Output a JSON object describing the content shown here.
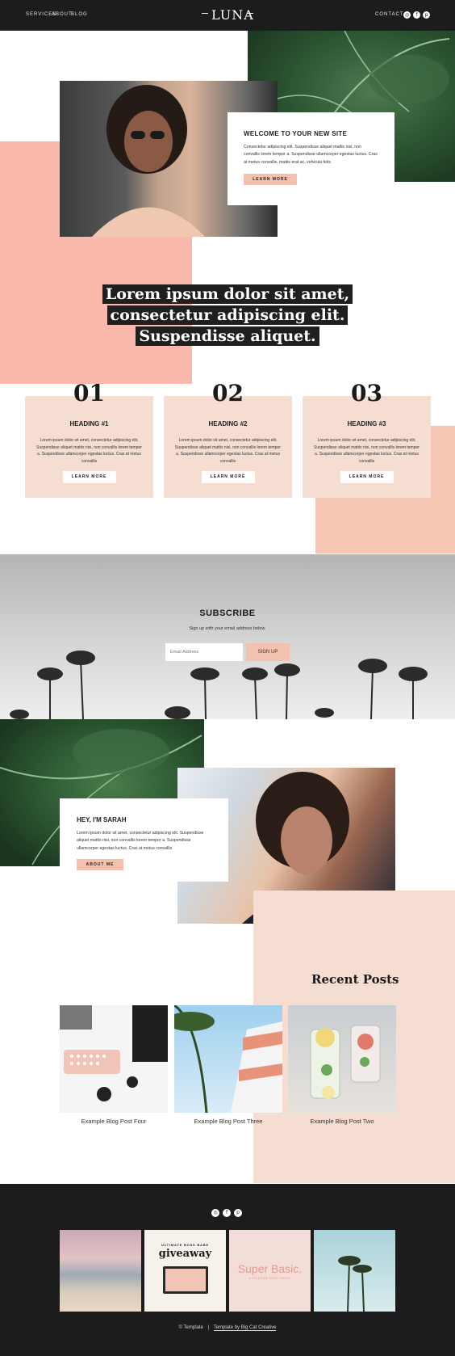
{
  "header": {
    "nav": [
      "SERVICES",
      "ABOUT",
      "BLOG"
    ],
    "logo": "LUNA",
    "contact": "CONTACT",
    "social_icons": [
      "instagram-icon",
      "facebook-icon",
      "pinterest-icon"
    ]
  },
  "welcome": {
    "title": "WELCOME TO YOUR NEW SITE",
    "text": "Consectetur adipiscing elit. Suspendisse aliquet mattis nisi, non convallis lorem tempor a. Suspendisse ullamcorper egestas luctus. Cras at metus convallis, mattis erat ac, vehicula felis.",
    "button": "LEARN MORE"
  },
  "headline": {
    "lines": [
      "Lorem ipsum dolor sit amet,",
      "consectetur adipiscing elit.",
      "Suspendisse aliquet."
    ]
  },
  "features": [
    {
      "number": "01",
      "heading": "HEADING #1",
      "text": "Lorem ipsum dolor sit amet, consectetur adipiscing elit. Suspendisse aliquet mattis nisi, non convallis lorem tempor a. Suspendisse ullamcorper egestas luctus. Cras at metus convallis",
      "button": "LEARN MORE"
    },
    {
      "number": "02",
      "heading": "HEADING #2",
      "text": "Lorem ipsum dolor sit amet, consectetur adipiscing elit. Suspendisse aliquet mattis nisi, non convallis lorem tempor a. Suspendisse ullamcorper egestas luctus. Cras at metus convallis",
      "button": "LEARN MORE"
    },
    {
      "number": "03",
      "heading": "HEADING #3",
      "text": "Lorem ipsum dolor sit amet, consectetur adipiscing elit. Suspendisse aliquet mattis nisi, non convallis lorem tempor a. Suspendisse ullamcorper egestas luctus. Cras at metus convallis",
      "button": "LEARN MORE"
    }
  ],
  "subscribe": {
    "title": "SUBSCRIBE",
    "subtitle": "Sign up with your email address below.",
    "placeholder": "Email Address",
    "button": "SIGN UP"
  },
  "about": {
    "title": "HEY, I'M SARAH",
    "text": "Lorem ipsum dolor sit amet, consectetur adipiscing elit. Suspendisse aliquet mattis nisi, non convallis lorem tempor a. Suspendisse ullamcorper egestas luctus. Cras at metus convallis",
    "button": "ABOUT ME"
  },
  "blog": {
    "title": "Recent Posts",
    "posts": [
      "Example Blog Post Four",
      "Example Blog Post Three",
      "Example Blog Post Two"
    ]
  },
  "footer": {
    "social_icons": [
      "instagram-icon",
      "facebook-icon",
      "pinterest-icon"
    ],
    "tiles": {
      "giveaway_small": "ULTIMATE BOSS BABE",
      "giveaway": "giveaway",
      "super_basic": "Super Basic.",
      "super_basic_small": "A MODERN SANS SERIF"
    },
    "credit_left": "© Template",
    "credit_sep": "|",
    "credit_right": "Template by Big Cat Creative"
  },
  "colors": {
    "dark": "#1c1c1c",
    "pink": "#fbb9ad",
    "peach": "#f3c2af",
    "blush": "#f6ddd2"
  }
}
